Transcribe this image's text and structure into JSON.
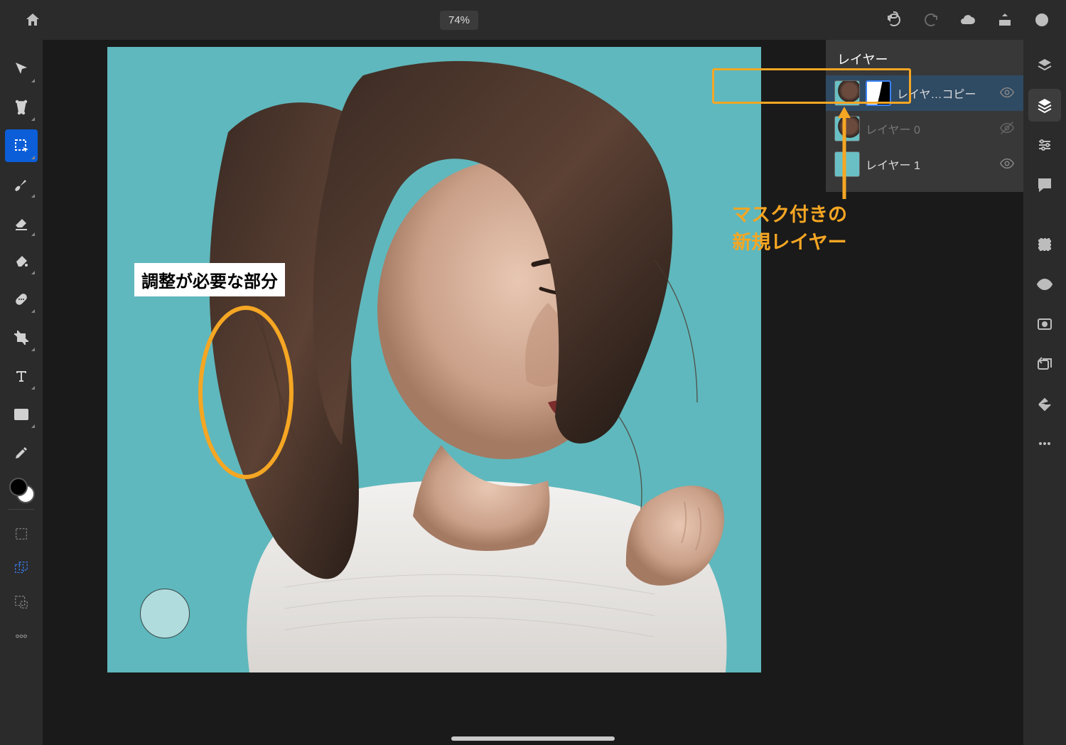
{
  "topbar": {
    "zoom": "74%"
  },
  "layers_panel": {
    "title": "レイヤー",
    "items": [
      {
        "name": "レイヤ…コピー",
        "visible": true,
        "selected": true,
        "has_mask": true
      },
      {
        "name": "レイヤー 0",
        "visible": false,
        "selected": false,
        "has_mask": false
      },
      {
        "name": "レイヤー 1",
        "visible": true,
        "selected": false,
        "has_mask": false
      }
    ]
  },
  "annotations": {
    "canvas_label": "調整が必要な部分",
    "right_line1": "マスク付きの",
    "right_line2": "新規レイヤー"
  },
  "colors": {
    "accent_orange": "#f5a623",
    "canvas_bg": "#5fb8bd",
    "tool_active": "#0b5ed7"
  }
}
